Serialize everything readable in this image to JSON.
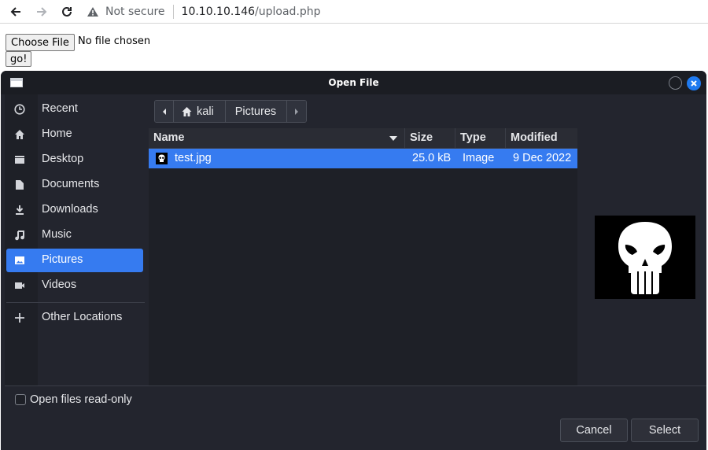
{
  "browser": {
    "security_text": "Not secure",
    "url_host": "10.10.10.146",
    "url_path": "/upload.php"
  },
  "page": {
    "choose_file_label": "Choose File",
    "file_status": "No file chosen",
    "submit_label": "go!"
  },
  "dialog": {
    "title": "Open File",
    "sidebar": {
      "items": [
        {
          "label": "Recent",
          "icon": "clock-icon"
        },
        {
          "label": "Home",
          "icon": "home-icon"
        },
        {
          "label": "Desktop",
          "icon": "desktop-icon"
        },
        {
          "label": "Documents",
          "icon": "document-icon"
        },
        {
          "label": "Downloads",
          "icon": "download-icon"
        },
        {
          "label": "Music",
          "icon": "music-icon"
        },
        {
          "label": "Pictures",
          "icon": "image-icon",
          "selected": true
        },
        {
          "label": "Videos",
          "icon": "video-icon"
        },
        {
          "label": "Other Locations",
          "icon": "plus-icon"
        }
      ]
    },
    "path": {
      "segments": [
        "kali",
        "Pictures"
      ]
    },
    "columns": {
      "name": "Name",
      "size": "Size",
      "type": "Type",
      "modified": "Modified"
    },
    "files": [
      {
        "name": "test.jpg",
        "size": "25.0 kB",
        "type": "Image",
        "modified": "9 Dec 2022",
        "selected": true
      }
    ],
    "readonly_label": "Open files read-only",
    "cancel_label": "Cancel",
    "select_label": "Select"
  },
  "colors": {
    "accent": "#367bf0",
    "dialog_bg": "#23252e",
    "list_bg": "#1e2027"
  }
}
